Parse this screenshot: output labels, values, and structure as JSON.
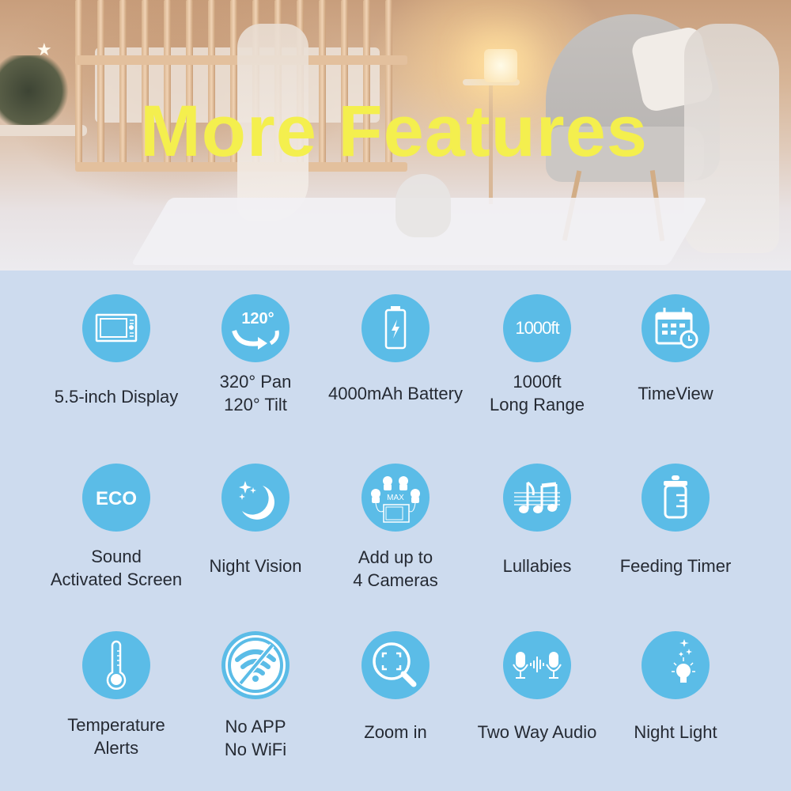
{
  "banner": {
    "title": "More Features"
  },
  "colors": {
    "title_yellow": "#f4ef4e",
    "icon_blue": "#5bbce7",
    "panel_background": "#cddbee",
    "text_dark": "#252a33"
  },
  "features": [
    {
      "icon": "display-screen-icon",
      "lines": [
        "5.5-inch Display"
      ]
    },
    {
      "icon": "pan-tilt-rotation-icon",
      "icon_text": "120°",
      "lines": [
        "320° Pan",
        "120° Tilt"
      ]
    },
    {
      "icon": "battery-charging-icon",
      "lines": [
        "4000mAh Battery"
      ]
    },
    {
      "icon": "range-distance-icon",
      "icon_text": "1000ft",
      "lines": [
        "1000ft",
        "Long Range"
      ]
    },
    {
      "icon": "calendar-clock-icon",
      "lines": [
        "TimeView"
      ]
    },
    {
      "icon": "eco-mode-icon",
      "icon_text": "ECO",
      "lines": [
        "Sound",
        "Activated Screen"
      ]
    },
    {
      "icon": "moon-stars-icon",
      "lines": [
        "Night Vision"
      ]
    },
    {
      "icon": "multi-camera-icon",
      "icon_text": "MAX",
      "lines": [
        "Add up to",
        "4 Cameras"
      ]
    },
    {
      "icon": "music-notes-icon",
      "lines": [
        "Lullabies"
      ]
    },
    {
      "icon": "baby-bottle-icon",
      "lines": [
        "Feeding Timer"
      ]
    },
    {
      "icon": "thermometer-icon",
      "lines": [
        "Temperature",
        "Alerts"
      ]
    },
    {
      "icon": "no-wifi-icon",
      "lines": [
        "No APP",
        "No WiFi"
      ]
    },
    {
      "icon": "zoom-magnifier-icon",
      "lines": [
        "Zoom in"
      ]
    },
    {
      "icon": "two-way-audio-icon",
      "lines": [
        "Two Way Audio"
      ]
    },
    {
      "icon": "night-light-icon",
      "lines": [
        "Night Light"
      ]
    }
  ]
}
